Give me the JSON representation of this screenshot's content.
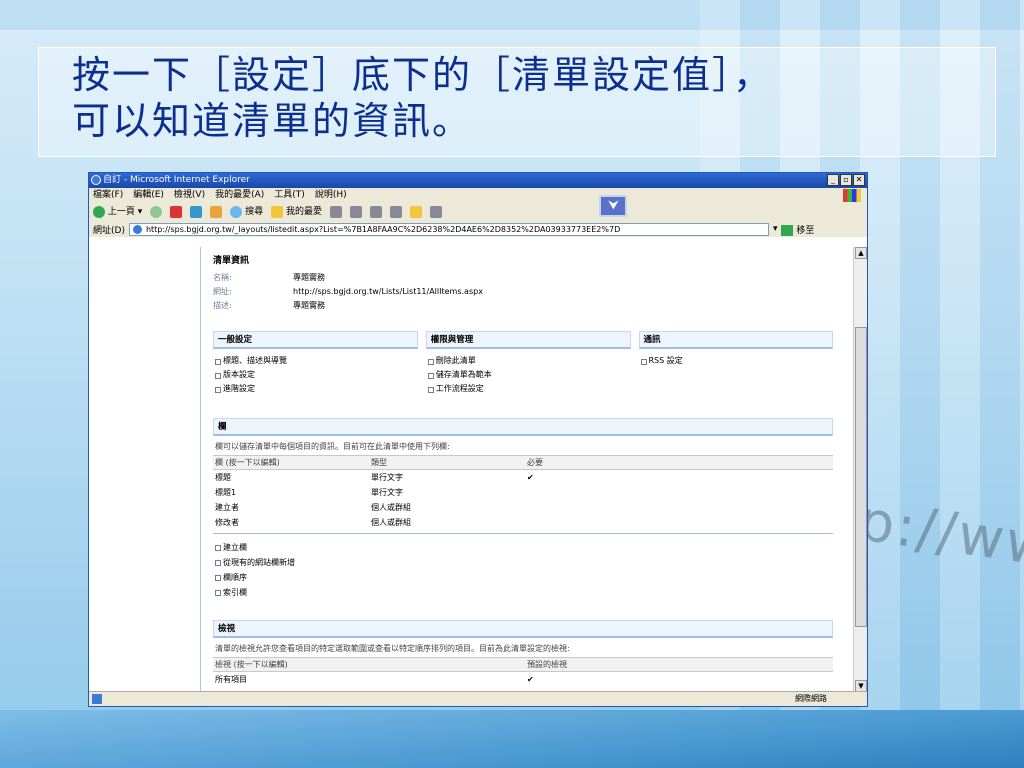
{
  "slide": {
    "title_line1": "按一下［設定］底下的［清單設定值］，",
    "title_line2": "可以知道清單的資訊。"
  },
  "background_text": "p://www",
  "browser": {
    "window_title": "自訂 - Microsoft Internet Explorer",
    "menu": [
      "檔案(F)",
      "編輯(E)",
      "檢視(V)",
      "我的最愛(A)",
      "工具(T)",
      "說明(H)"
    ],
    "toolbar": {
      "back": "上一頁",
      "search": "搜尋",
      "favorites": "我的最愛"
    },
    "address_label": "網址(D)",
    "address_value": "http://sps.bgjd.org.tw/_layouts/listedit.aspx?List=%7B1A8FAA9C%2D6238%2D4AE6%2D8352%2DA03933773EE2%7D",
    "go_label": "移至",
    "status_zone": "網際網路"
  },
  "list_info": {
    "section_title": "清單資訊",
    "rows": [
      {
        "k": "名稱:",
        "v": "專題實務"
      },
      {
        "k": "網址:",
        "v": "http://sps.bgjd.org.tw/Lists/List11/AllItems.aspx"
      },
      {
        "k": "描述:",
        "v": "專題實務"
      }
    ]
  },
  "settings": {
    "general": {
      "title": "一般設定",
      "items": [
        "標題、描述與導覽",
        "版本設定",
        "進階設定"
      ]
    },
    "permissions": {
      "title": "權限與管理",
      "items": [
        "刪除此清單",
        "儲存清單為範本",
        "工作流程設定"
      ]
    },
    "communications": {
      "title": "通訊",
      "items": [
        "RSS 設定"
      ]
    }
  },
  "columns": {
    "title": "欄",
    "description": "欄可以儲存清單中每個項目的資訊。目前可在此清單中使用下列欄:",
    "headers": [
      "欄 (按一下以編輯)",
      "類型",
      "必要"
    ],
    "rows": [
      [
        "標題",
        "單行文字",
        "✔"
      ],
      [
        "標題1",
        "單行文字",
        ""
      ],
      [
        "建立者",
        "個人或群組",
        ""
      ],
      [
        "修改者",
        "個人或群組",
        ""
      ]
    ],
    "links": [
      "建立欄",
      "從現有的網站欄新增",
      "欄順序",
      "索引欄"
    ]
  },
  "views": {
    "title": "檢視",
    "description": "清單的檢視允許您查看項目的特定選取範圍或查看以特定順序排列的項目。目前為此清單設定的檢視:",
    "headers": [
      "檢視 (按一下以編輯)",
      "預設的檢視"
    ],
    "rows": [
      [
        "所有項目",
        "✔"
      ]
    ]
  }
}
